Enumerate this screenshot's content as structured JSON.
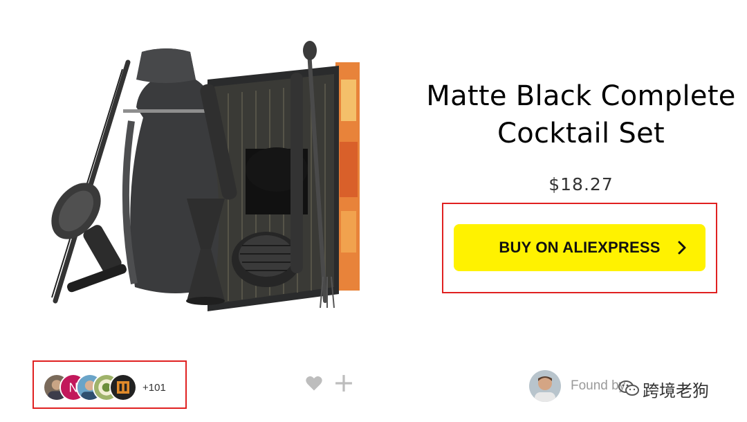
{
  "product": {
    "title_line1": "Matte Black Complete",
    "title_line2": "Cocktail Set",
    "price": "$18.27",
    "image_alt": "matte black cocktail set"
  },
  "buy": {
    "label": "BUY ON ALIEXPRESS",
    "chevron_icon": "chevron-right-icon",
    "color": "#fff200"
  },
  "users": {
    "count_label": "+101",
    "avatars": [
      "user-avatar-1",
      "user-avatar-n",
      "user-avatar-3",
      "user-avatar-4",
      "user-avatar-5"
    ],
    "initial": "N"
  },
  "actions": {
    "heart_icon": "heart-icon",
    "add_icon": "plus-icon"
  },
  "finder": {
    "label": "Found by",
    "watermark": "跨境老狗",
    "watermark_icon": "wechat-icon"
  },
  "colors": {
    "highlight": "#e02020",
    "icon_gray": "#bdbdbd"
  }
}
